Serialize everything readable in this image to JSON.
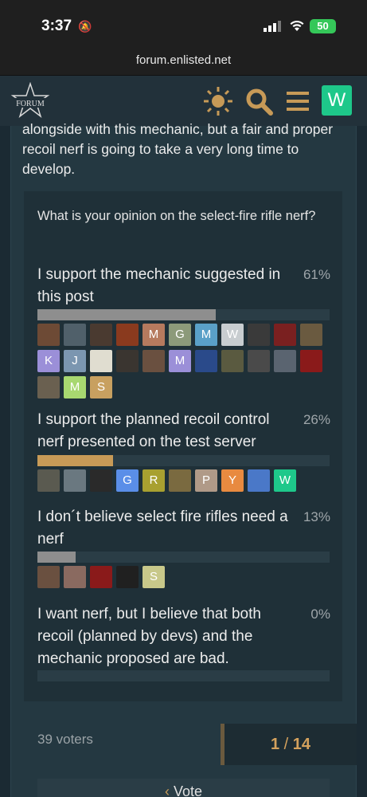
{
  "status": {
    "time": "3:37",
    "battery": "50"
  },
  "browser": {
    "url": "forum.enlisted.net"
  },
  "header": {
    "logo_text": "FORUM",
    "user_initial": "W"
  },
  "post": {
    "text": "alongside with this mechanic, but a fair and proper recoil nerf is going to take a very long time to develop."
  },
  "poll": {
    "question": "What is your opinion on the select-fire rifle nerf?",
    "options": [
      {
        "label": "I support the mechanic suggested in this post",
        "percent": "61%",
        "value": 61,
        "bar_color": "#8e8e8e",
        "voters": [
          {
            "type": "img",
            "color": "#6d4a35"
          },
          {
            "type": "img",
            "color": "#50606a"
          },
          {
            "type": "img",
            "color": "#4a3a30"
          },
          {
            "type": "img",
            "color": "#8a3a1e"
          },
          {
            "type": "letter",
            "letter": "M",
            "color": "#b67a5e"
          },
          {
            "type": "letter",
            "letter": "G",
            "color": "#8c9a7a"
          },
          {
            "type": "letter",
            "letter": "M",
            "color": "#5aa0c8"
          },
          {
            "type": "letter",
            "letter": "W",
            "color": "#c8cdd0"
          },
          {
            "type": "img",
            "color": "#3a3a3a"
          },
          {
            "type": "img",
            "color": "#7a2020"
          },
          {
            "type": "img",
            "color": "#6a5a40"
          },
          {
            "type": "letter",
            "letter": "K",
            "color": "#9b8fd8"
          },
          {
            "type": "letter",
            "letter": "J",
            "color": "#7b96b0"
          },
          {
            "type": "img",
            "color": "#e0ddd0"
          },
          {
            "type": "img",
            "color": "#3a3530"
          },
          {
            "type": "img",
            "color": "#6a5040"
          },
          {
            "type": "letter",
            "letter": "M",
            "color": "#9b8fd8"
          },
          {
            "type": "img",
            "color": "#2a4a8a"
          },
          {
            "type": "img",
            "color": "#5a5a40"
          },
          {
            "type": "img",
            "color": "#4a4a4a"
          },
          {
            "type": "img",
            "color": "#5a6470"
          },
          {
            "type": "img",
            "color": "#8a1a1a"
          },
          {
            "type": "img",
            "color": "#6a6050"
          },
          {
            "type": "letter",
            "letter": "M",
            "color": "#a8d870"
          },
          {
            "type": "letter",
            "letter": "S",
            "color": "#c8a060"
          }
        ]
      },
      {
        "label": "I support the planned recoil control nerf presented on the test server",
        "percent": "26%",
        "value": 26,
        "bar_color": "#c79a57",
        "voters": [
          {
            "type": "img",
            "color": "#5a5a50"
          },
          {
            "type": "img",
            "color": "#6a7880"
          },
          {
            "type": "img",
            "color": "#2a2a2a"
          },
          {
            "type": "letter",
            "letter": "G",
            "color": "#5a8ee8"
          },
          {
            "type": "letter",
            "letter": "R",
            "color": "#a8a030"
          },
          {
            "type": "img",
            "color": "#7a6a40"
          },
          {
            "type": "letter",
            "letter": "P",
            "color": "#b09a88"
          },
          {
            "type": "letter",
            "letter": "Y",
            "color": "#e88a40"
          },
          {
            "type": "img",
            "color": "#4a78c8"
          },
          {
            "type": "letter",
            "letter": "W",
            "color": "#1ec88a"
          }
        ]
      },
      {
        "label": "I don´t believe select fire rifles need a nerf",
        "percent": "13%",
        "value": 13,
        "bar_color": "#8e8e8e",
        "voters": [
          {
            "type": "img",
            "color": "#6a5040"
          },
          {
            "type": "img",
            "color": "#8a6a60"
          },
          {
            "type": "img",
            "color": "#8a1a1a"
          },
          {
            "type": "img",
            "color": "#202020"
          },
          {
            "type": "letter",
            "letter": "S",
            "color": "#c8c88a"
          }
        ]
      },
      {
        "label": "I want nerf, but I believe that both recoil (planned by devs) and the mechanic proposed are bad.",
        "percent": "0%",
        "value": 0,
        "bar_color": "#8e8e8e",
        "voters": []
      }
    ],
    "voters_count": "39 voters",
    "page": "1",
    "page_sep": "/",
    "page_total": "14",
    "vote_label": "Vote"
  }
}
